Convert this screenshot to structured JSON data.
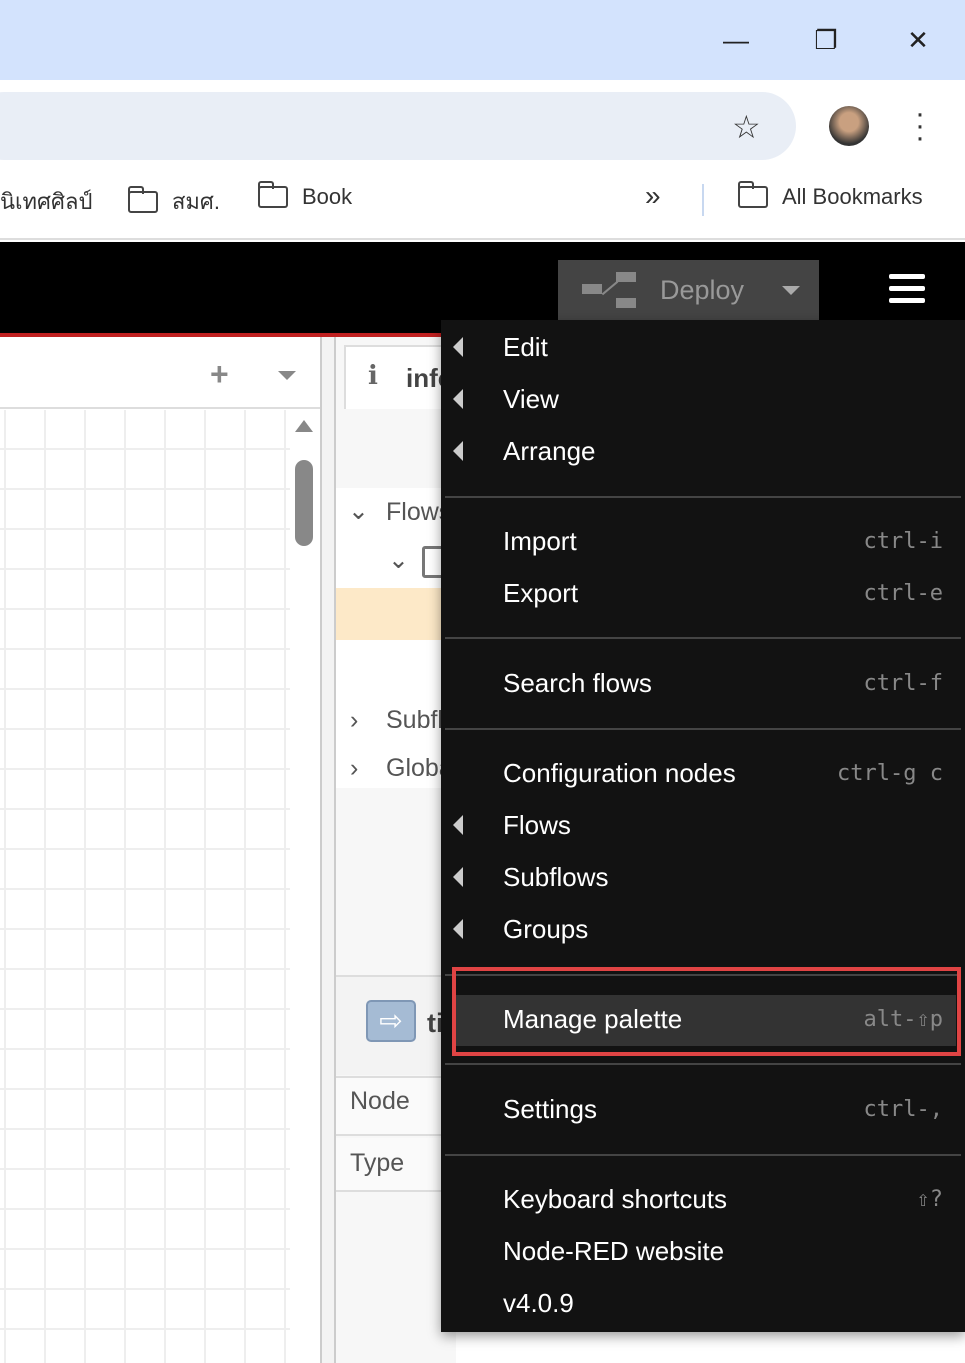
{
  "browser": {
    "bookmarks": [
      {
        "label": "นิเทศศิลป์"
      },
      {
        "label": "สมศ."
      },
      {
        "label": "Book"
      }
    ],
    "all_bookmarks": "All Bookmarks",
    "more": "»"
  },
  "header": {
    "deploy_label": "Deploy"
  },
  "sidebar": {
    "tab_label": "info",
    "flows": "Flows",
    "subflows": "Subflows",
    "global": "Global",
    "node_label": "Node",
    "type_label": "Type",
    "node_name": "ti"
  },
  "menu": {
    "items": [
      {
        "label": "Edit",
        "submenu": true
      },
      {
        "label": "View",
        "submenu": true
      },
      {
        "label": "Arrange",
        "submenu": true
      },
      {
        "label": "Import",
        "shortcut": "ctrl-i"
      },
      {
        "label": "Export",
        "shortcut": "ctrl-e"
      },
      {
        "label": "Search flows",
        "shortcut": "ctrl-f"
      },
      {
        "label": "Configuration nodes",
        "shortcut": "ctrl-g c"
      },
      {
        "label": "Flows",
        "submenu": true
      },
      {
        "label": "Subflows",
        "submenu": true
      },
      {
        "label": "Groups",
        "submenu": true
      },
      {
        "label": "Manage palette",
        "shortcut": "alt-⇧p",
        "highlighted": true
      },
      {
        "label": "Settings",
        "shortcut": "ctrl-,"
      },
      {
        "label": "Keyboard shortcuts",
        "shortcut": "⇧?"
      },
      {
        "label": "Node-RED website"
      },
      {
        "label": "v4.0.9"
      }
    ]
  },
  "colors": {
    "highlight_box": "#e04444",
    "header": "#000000",
    "menu_bg": "#121212"
  }
}
